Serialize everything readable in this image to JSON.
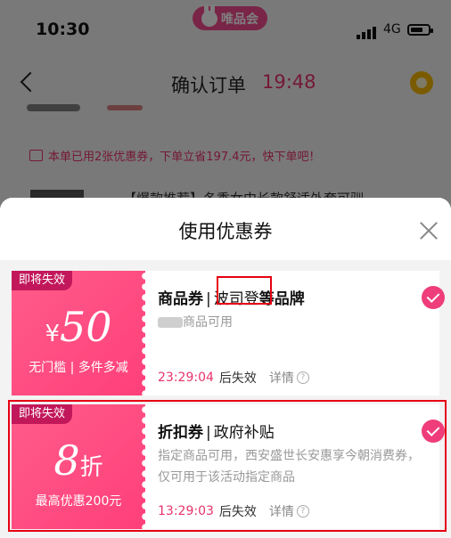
{
  "status_bar": {
    "time": "10:30",
    "network": "4G"
  },
  "brand": {
    "name": "唯品会"
  },
  "header": {
    "title": "确认订单",
    "timer": "19:48"
  },
  "notice": {
    "text": "本单已用2张优惠券，下单立省197.4元，快下单吧！"
  },
  "background_product": {
    "title": "【爆款推荐】冬季女中长款舒适外套可驯"
  },
  "sheet": {
    "title": "使用优惠券"
  },
  "coupons": [
    {
      "tag": "即将失效",
      "amount_prefix": "¥",
      "amount": "50",
      "amount_suffix": "",
      "condition": "无门槛 | 多件多减",
      "type": "商品券",
      "separator": "|",
      "brand": "波司登",
      "title_rest": "等品牌",
      "description": "商品可用",
      "expiry_time": "23:29:04",
      "expiry_text": "后失效",
      "detail": "详情",
      "selected": true
    },
    {
      "tag": "即将失效",
      "amount_prefix": "",
      "amount": "8",
      "amount_suffix": "折",
      "condition": "最高优惠200元",
      "type": "折扣券",
      "separator": "|",
      "title_rest": "政府补贴",
      "description": "指定商品可用，西安盛世长安惠享今朝消费券，仅可用于该活动指定商品",
      "expiry_time": "13:29:03",
      "expiry_text": "后失效",
      "detail": "详情",
      "selected": true
    }
  ],
  "colors": {
    "accent": "#e8336b",
    "coupon_pink": "#ff4a80",
    "highlight_red": "#e60012"
  },
  "icons": [
    "back-icon",
    "help-icon",
    "close-icon",
    "check-icon",
    "question-icon"
  ]
}
